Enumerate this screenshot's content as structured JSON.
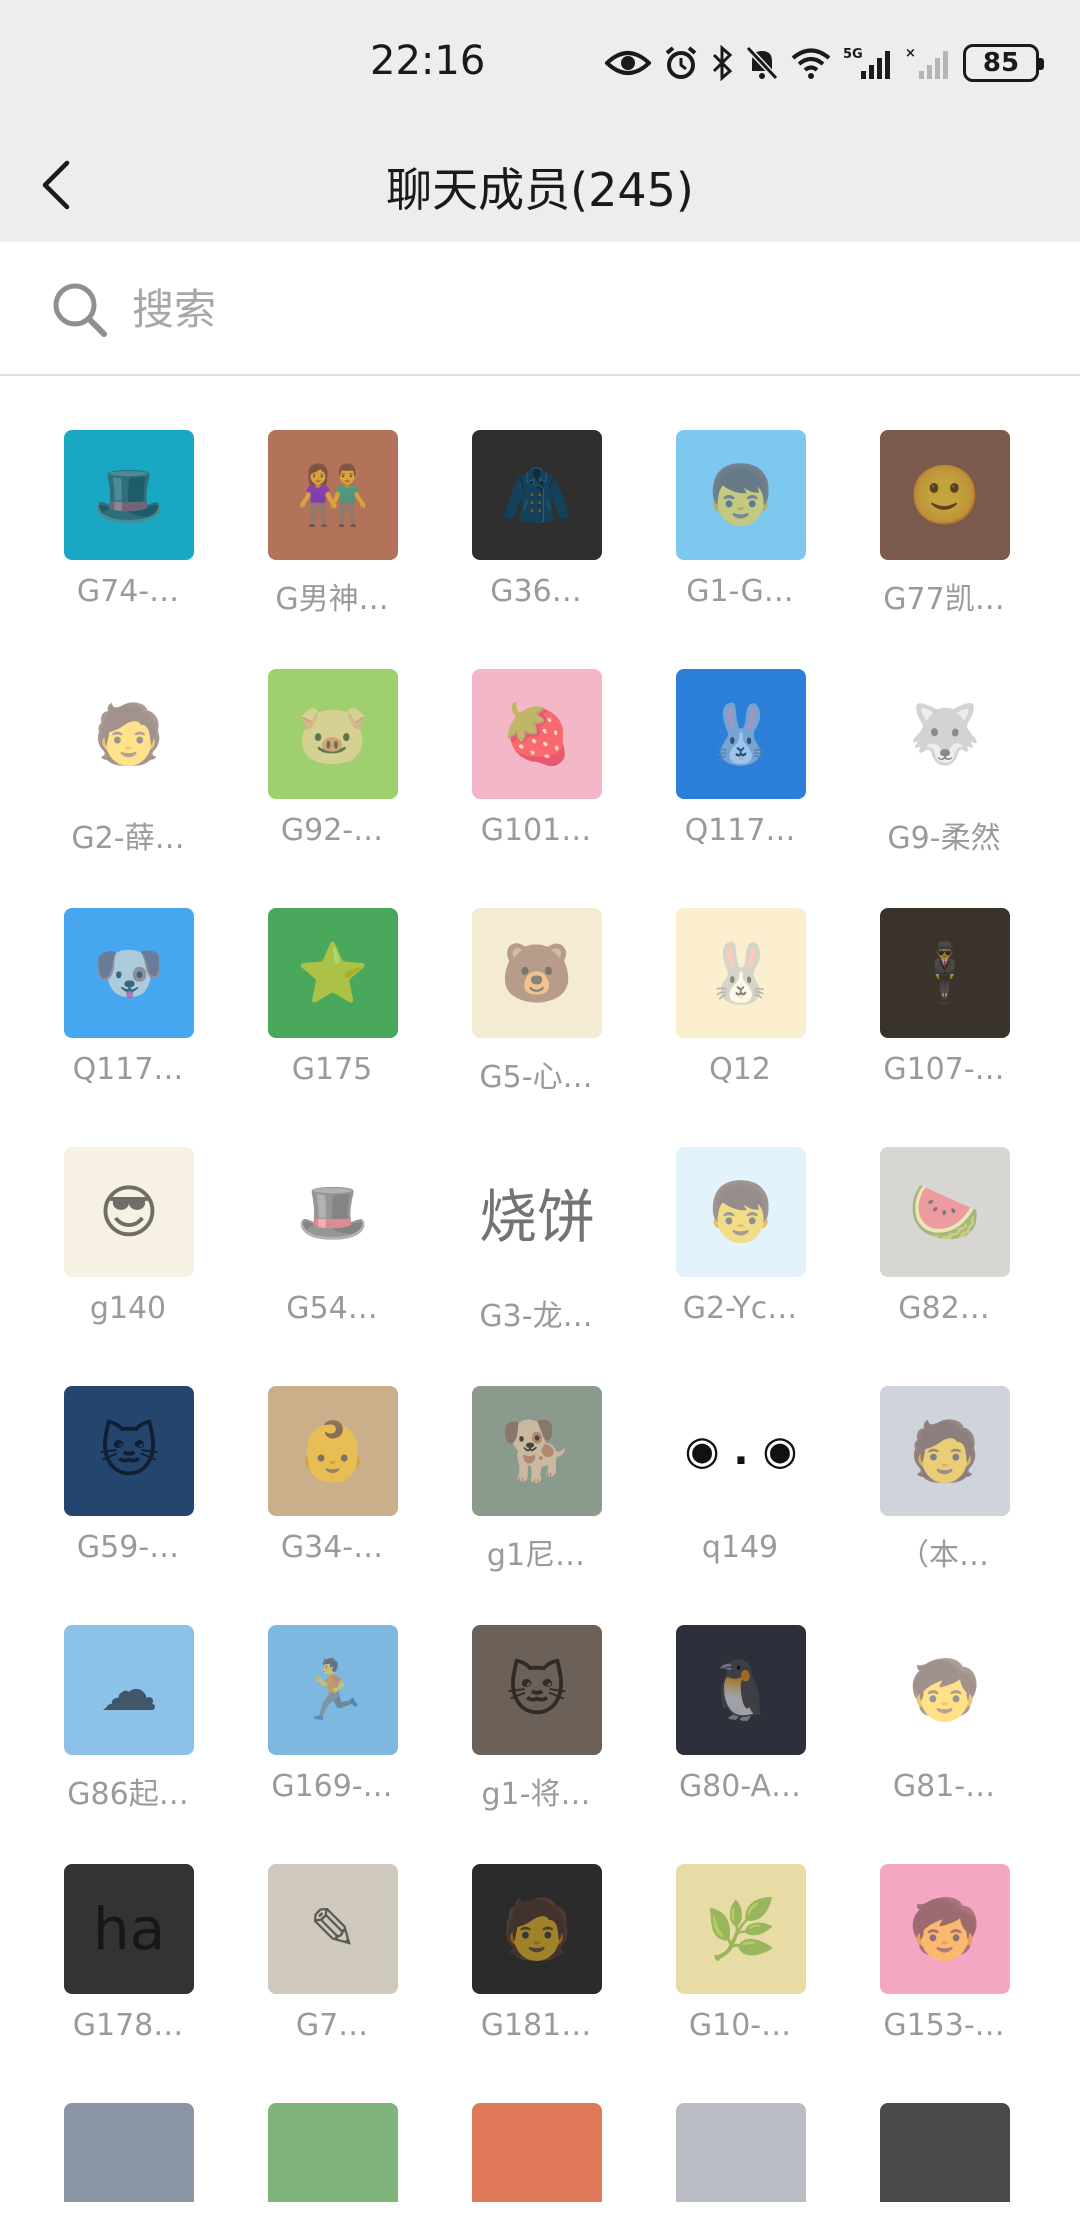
{
  "status_bar": {
    "time": "22:16",
    "battery": "85",
    "network": "5G",
    "icons": [
      "eye-icon",
      "alarm-icon",
      "bluetooth-icon",
      "mute-icon",
      "wifi-icon",
      "signal-5g-icon",
      "signal-no-sim-icon",
      "battery-icon"
    ]
  },
  "header": {
    "title": "聊天成员(245)",
    "back_icon": "chevron-left-icon"
  },
  "search": {
    "placeholder": "搜索",
    "value": ""
  },
  "members": [
    {
      "name": "G74-…",
      "color": "#1aa7c4",
      "glyph": "🎩"
    },
    {
      "name": "G男神…",
      "color": "#b2735a",
      "glyph": "👫"
    },
    {
      "name": "G36…",
      "color": "#2f2f2f",
      "glyph": "🧥"
    },
    {
      "name": "G1-G…",
      "color": "#7cc8ef",
      "glyph": "👦"
    },
    {
      "name": "G77凯…",
      "color": "#7a5a4c",
      "glyph": "🙂"
    },
    {
      "name": "G2-薛…",
      "color": "#ffffff",
      "glyph": "🧑"
    },
    {
      "name": "G92-…",
      "color": "#9fcf6f",
      "glyph": "🐷"
    },
    {
      "name": "G101…",
      "color": "#f3b7c8",
      "glyph": "🍓"
    },
    {
      "name": "Q117…",
      "color": "#2b7fd9",
      "glyph": "🐰"
    },
    {
      "name": "G9-柔然",
      "color": "#ffffff",
      "glyph": "🐺"
    },
    {
      "name": "Q117…",
      "color": "#46a6f0",
      "glyph": "🐶"
    },
    {
      "name": "G175",
      "color": "#49a85b",
      "glyph": "⭐"
    },
    {
      "name": "G5-心…",
      "color": "#f4ecd2",
      "glyph": "🐻"
    },
    {
      "name": "Q12",
      "color": "#fbefd0",
      "glyph": "🐰"
    },
    {
      "name": "G107-…",
      "color": "#3a332c",
      "glyph": "🕴"
    },
    {
      "name": "g140",
      "color": "#f7f1e3",
      "glyph": "😎"
    },
    {
      "name": "G54…",
      "color": "#ffffff",
      "glyph": "🎩"
    },
    {
      "name": "G3-龙…",
      "color": "#ffffff",
      "glyph": "烧饼"
    },
    {
      "name": "G2-Yc…",
      "color": "#e3f3fb",
      "glyph": "👦"
    },
    {
      "name": "G82…",
      "color": "#d8d6d3",
      "glyph": "🍉"
    },
    {
      "name": "G59-…",
      "color": "#24466e",
      "glyph": "🐱"
    },
    {
      "name": "G34-…",
      "color": "#c9b08a",
      "glyph": "👶"
    },
    {
      "name": "g1尼…",
      "color": "#8a9a8c",
      "glyph": "🐕"
    },
    {
      "name": "q149",
      "color": "#ffffff",
      "glyph": "◉ . ◉"
    },
    {
      "name": "（本…",
      "color": "#cfd3da",
      "glyph": "🧑"
    },
    {
      "name": "G86起…",
      "color": "#8cc2e8",
      "glyph": "☁"
    },
    {
      "name": "G169-…",
      "color": "#7cb8df",
      "glyph": "🏃"
    },
    {
      "name": "g1-将…",
      "color": "#6b6158",
      "glyph": "🐱"
    },
    {
      "name": "G80-A…",
      "color": "#2d2f3a",
      "glyph": "🐧"
    },
    {
      "name": "G81-…",
      "color": "#ffffff",
      "glyph": "🧒"
    },
    {
      "name": "G178…",
      "color": "#333333",
      "glyph": "ha"
    },
    {
      "name": "G7…",
      "color": "#cfc8bd",
      "glyph": "✎"
    },
    {
      "name": "G181…",
      "color": "#2b2b2b",
      "glyph": "🧑"
    },
    {
      "name": "G10-…",
      "color": "#e7dca6",
      "glyph": "🌿"
    },
    {
      "name": "G153-…",
      "color": "#f4a7c2",
      "glyph": "🧒"
    },
    {
      "name": "",
      "color": "#8a96a3",
      "glyph": ""
    },
    {
      "name": "",
      "color": "#7fb37a",
      "glyph": ""
    },
    {
      "name": "",
      "color": "#e0785a",
      "glyph": ""
    },
    {
      "name": "",
      "color": "#b9bcc2",
      "glyph": ""
    },
    {
      "name": "",
      "color": "#4a4a4a",
      "glyph": ""
    }
  ]
}
